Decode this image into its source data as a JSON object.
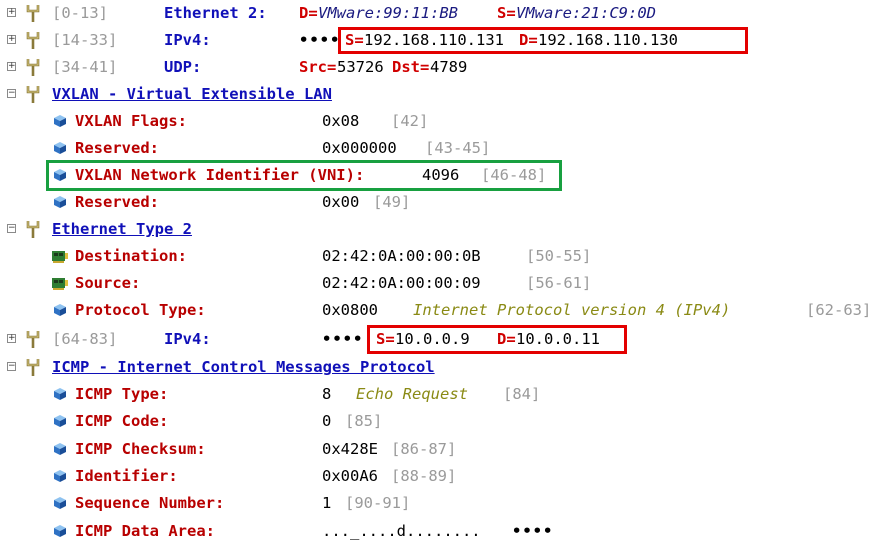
{
  "rows": [
    {
      "range": "[0-13]",
      "proto": "Ethernet 2:",
      "d_label": "D=",
      "d_value": "VMware:99:11:BB",
      "s_label": "S=",
      "s_value": "VMware:21:C9:0D"
    },
    {
      "range": "[14-33]",
      "proto": "IPv4:",
      "ellipsis": "••••",
      "s_label": "S=",
      "s_value": "192.168.110.131",
      "d_label": "D=",
      "d_value": "192.168.110.130"
    },
    {
      "range": "[34-41]",
      "proto": "UDP:",
      "src_label": "Src=",
      "src_value": "53726",
      "dst_label": "Dst=",
      "dst_value": "4789"
    },
    {
      "title": "VXLAN - Virtual Extensible LAN"
    },
    {
      "name": "VXLAN Flags:",
      "value": "0x08",
      "range": "[42]"
    },
    {
      "name": "Reserved:",
      "value": "0x000000",
      "range": "[43-45]"
    },
    {
      "name": "VXLAN Network Identifier (VNI):",
      "value": "4096",
      "range": "[46-48]"
    },
    {
      "name": "Reserved:",
      "value": "0x00",
      "range": "[49]"
    },
    {
      "title": "Ethernet Type 2"
    },
    {
      "name": "Destination:",
      "value": "02:42:0A:00:00:0B",
      "range": "[50-55]"
    },
    {
      "name": "Source:",
      "value": "02:42:0A:00:00:09",
      "range": "[56-61]"
    },
    {
      "name": "Protocol Type:",
      "value": "0x0800",
      "desc": "Internet Protocol version 4 (IPv4)",
      "range": "[62-63]"
    },
    {
      "range": "[64-83]",
      "proto": "IPv4:",
      "ellipsis": "••••",
      "s_label": "S=",
      "s_value": "10.0.0.9",
      "d_label": "D=",
      "d_value": "10.0.0.11"
    },
    {
      "title": "ICMP - Internet Control Messages Protocol"
    },
    {
      "name": "ICMP Type:",
      "value": "8",
      "desc": "Echo Request",
      "range": "[84]"
    },
    {
      "name": "ICMP Code:",
      "value": "0",
      "range": "[85]"
    },
    {
      "name": "ICMP Checksum:",
      "value": "0x428E",
      "range": "[86-87]"
    },
    {
      "name": "Identifier:",
      "value": "0x00A6",
      "range": "[88-89]"
    },
    {
      "name": "Sequence Number:",
      "value": "1",
      "range": "[90-91]"
    },
    {
      "name": "ICMP Data Area:",
      "value": "..._....d........",
      "ellipsis": "••••"
    }
  ],
  "icons": {
    "expand": "expand-box-icon",
    "protocol": "tuning-fork-icon",
    "field": "blue-cube-icon",
    "mac": "network-card-icon"
  },
  "colors": {
    "highlight_red": "#e30000",
    "highlight_green": "#18a040",
    "protocol_blue": "#1010b8",
    "field_red": "#b80000",
    "description_olive": "#8a8a14"
  },
  "expanders": {
    "collapsed": "+",
    "expanded": "−"
  }
}
